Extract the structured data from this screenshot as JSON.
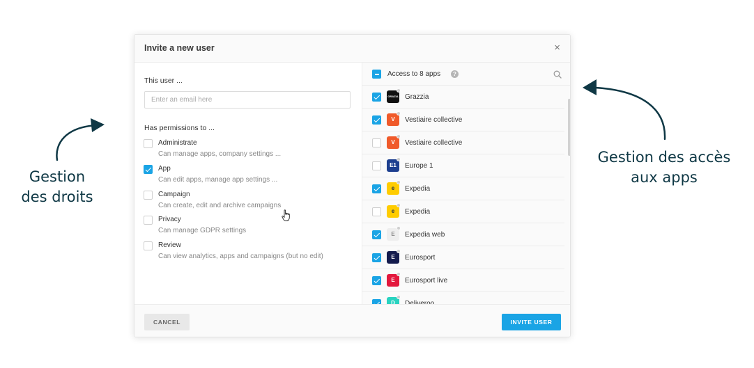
{
  "annotations": {
    "left_line1": "Gestion",
    "left_line2": "des droits",
    "right_line1": "Gestion des accès",
    "right_line2": "aux apps",
    "color": "#0f3845"
  },
  "modal": {
    "title": "Invite a new user",
    "close_icon": "close-icon"
  },
  "user_section": {
    "label": "This user ...",
    "email_placeholder": "Enter an email here",
    "email_value": ""
  },
  "permissions": {
    "label": "Has permissions to ...",
    "items": [
      {
        "name": "Administrate",
        "description": "Can manage apps, company settings ...",
        "checked": false
      },
      {
        "name": "App",
        "description": "Can edit apps, manage app settings ...",
        "checked": true
      },
      {
        "name": "Campaign",
        "description": "Can create, edit and archive campaigns",
        "checked": false
      },
      {
        "name": "Privacy",
        "description": "Can manage GDPR settings",
        "checked": false
      },
      {
        "name": "Review",
        "description": "Can view analytics, apps and campaigns (but no edit)",
        "checked": false
      }
    ]
  },
  "apps": {
    "header_label": "Access to 8 apps",
    "help_icon_text": "?",
    "select_all_state": "partial",
    "search_icon": "search-icon",
    "items": [
      {
        "name": "Grazzia",
        "checked": true,
        "logo_text": "GRAZIA",
        "logo_bg": "#111111",
        "logo_color": "#ffffff"
      },
      {
        "name": "Vestiaire collective",
        "checked": true,
        "logo_text": "V",
        "logo_bg": "#f05a2a",
        "logo_color": "#ffffff"
      },
      {
        "name": "Vestiaire collective",
        "checked": false,
        "logo_text": "V",
        "logo_bg": "#f05a2a",
        "logo_color": "#ffffff"
      },
      {
        "name": "Europe 1",
        "checked": false,
        "logo_text": "E1",
        "logo_bg": "#1d3f8f",
        "logo_color": "#ffffff"
      },
      {
        "name": "Expedia",
        "checked": true,
        "logo_text": "e",
        "logo_bg": "#ffcc00",
        "logo_color": "#1b2b4a"
      },
      {
        "name": "Expedia",
        "checked": false,
        "logo_text": "e",
        "logo_bg": "#ffcc00",
        "logo_color": "#1b2b4a"
      },
      {
        "name": "Expedia web",
        "checked": true,
        "logo_text": "E",
        "logo_bg": "#eeeeee",
        "logo_color": "#888888"
      },
      {
        "name": "Eurosport",
        "checked": true,
        "logo_text": "E",
        "logo_bg": "#141b4d",
        "logo_color": "#ffffff"
      },
      {
        "name": "Eurosport live",
        "checked": true,
        "logo_text": "E",
        "logo_bg": "#e3183d",
        "logo_color": "#ffffff"
      },
      {
        "name": "Deliveroo",
        "checked": true,
        "logo_text": "D",
        "logo_bg": "#29d3c0",
        "logo_color": "#ffffff"
      }
    ]
  },
  "footer": {
    "cancel_label": "CANCEL",
    "invite_label": "INVITE USER"
  },
  "colors": {
    "accent": "#1aa4e5",
    "annotation": "#0f3845"
  }
}
